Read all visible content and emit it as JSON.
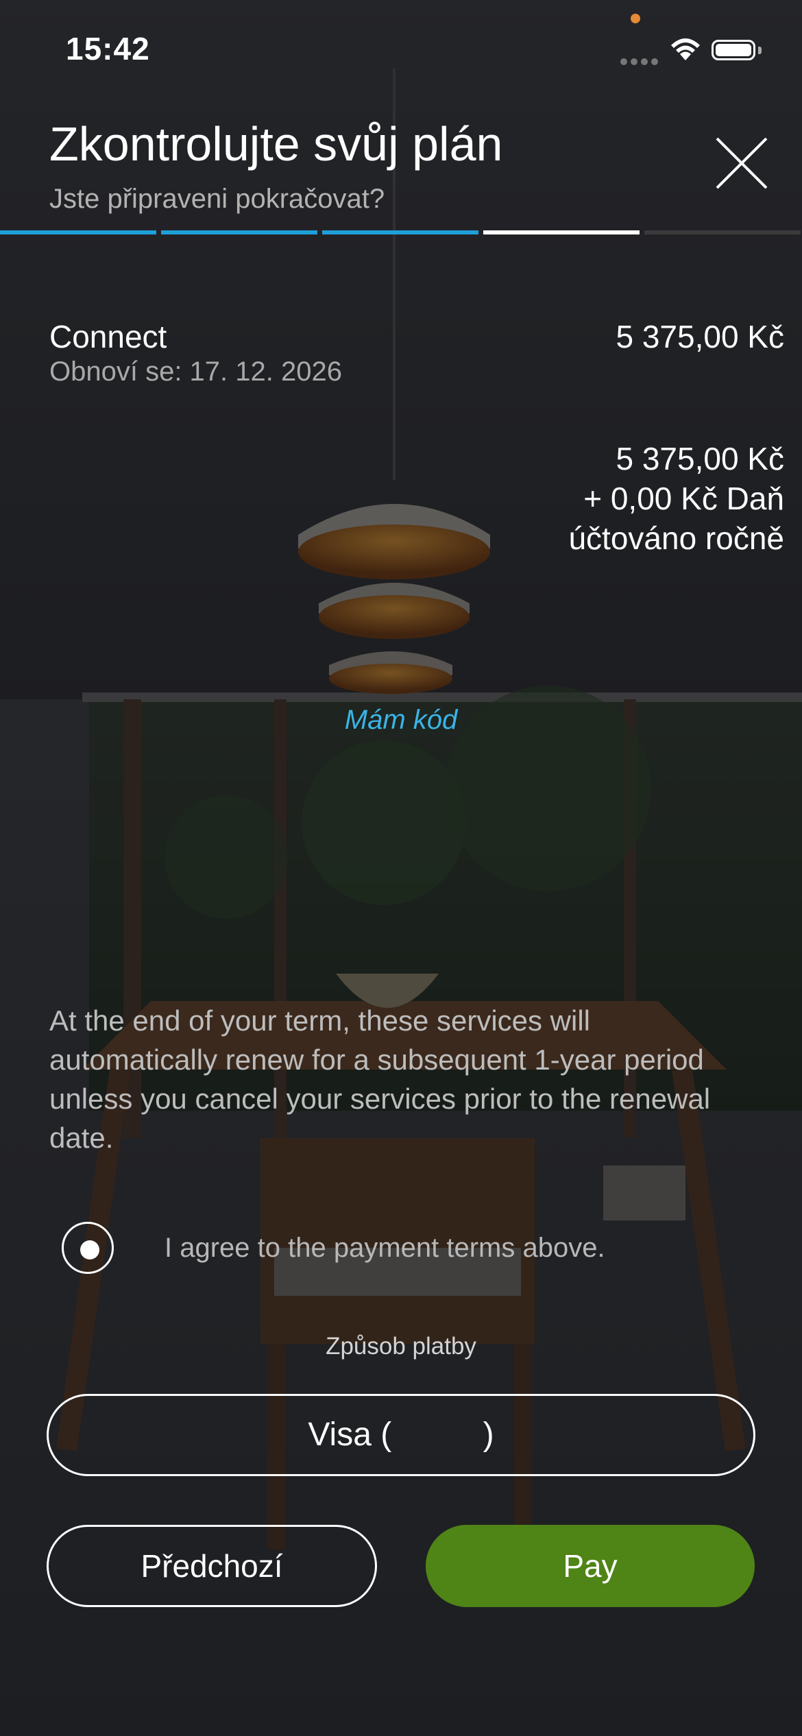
{
  "status_bar": {
    "time": "15:42"
  },
  "header": {
    "title": "Zkontrolujte svůj plán",
    "subtitle": "Jste připraveni pokračovat?",
    "progress": {
      "total_steps": 5,
      "completed_steps": 3,
      "current_step": 4
    }
  },
  "plan": {
    "name": "Connect",
    "renewal": "Obnoví se: 17. 12. 2026",
    "price": "5 375,00 Kč"
  },
  "totals": {
    "amount": "5 375,00 Kč",
    "tax": "+ 0,00 Kč Daň",
    "billing": "účtováno ročně"
  },
  "promo_link": "Mám kód",
  "terms_text": "At the end of your term, these services will automatically renew for a subsequent 1-year period unless you cancel your services prior to the renewal date.",
  "agree_label": "I agree to the payment terms above.",
  "payment": {
    "label": "Způsob platby",
    "selected": "Visa (          )"
  },
  "buttons": {
    "previous": "Předchozí",
    "pay": "Pay"
  },
  "colors": {
    "accent": "#3ab4e6",
    "pay_button": "#4f8416",
    "progress_done": "#1f9fd8",
    "progress_current": "#ffffff",
    "progress_pending": "#3a3a3a"
  },
  "icons": {
    "close": "close-icon",
    "radio": "radio-selected-icon",
    "wifi": "wifi-icon",
    "battery": "battery-icon"
  }
}
